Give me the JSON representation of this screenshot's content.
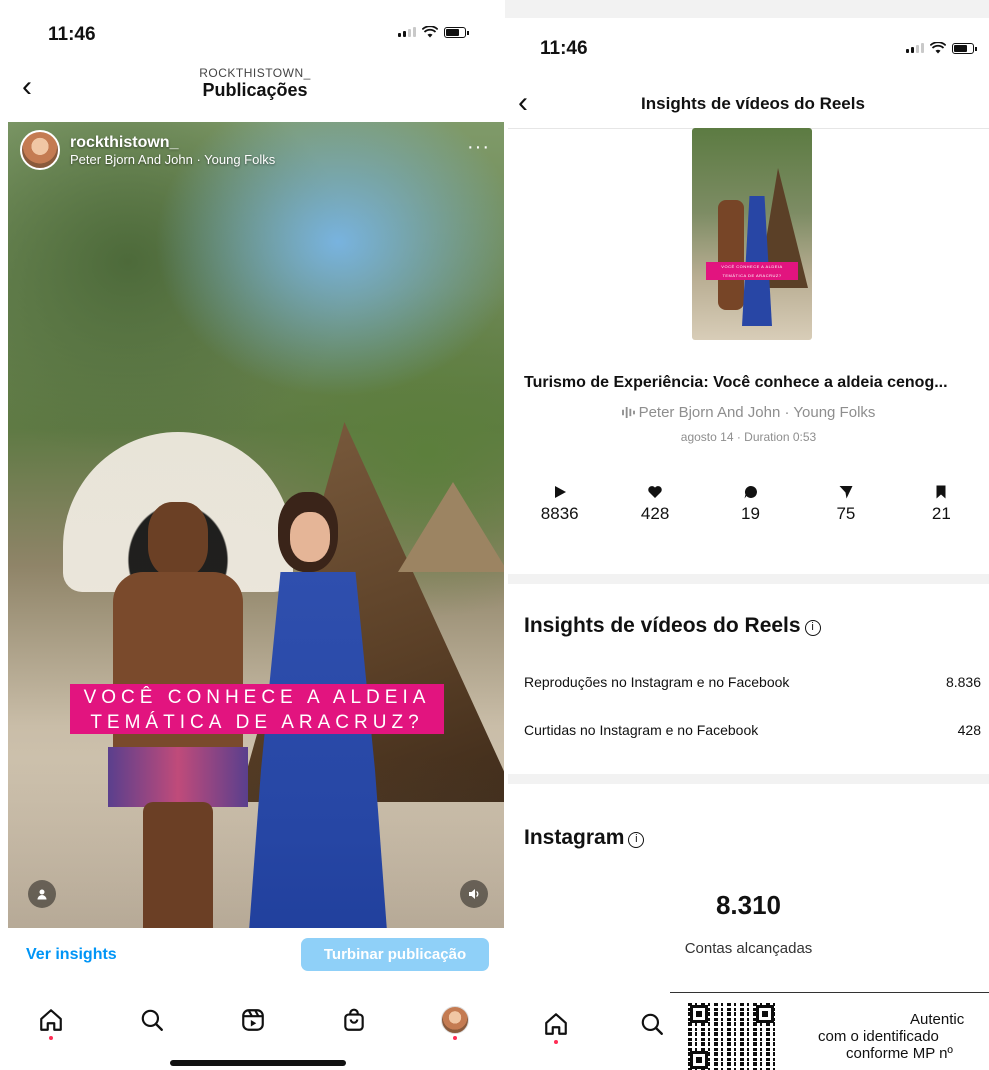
{
  "left": {
    "status_time": "11:46",
    "nav_subtitle": "ROCKTHISTOWN_",
    "nav_title": "Publicações",
    "post": {
      "username": "rockthistown_",
      "music": "Peter Bjorn And John · Young Folks",
      "more": "···",
      "caption_line1": "VOCÊ CONHECE A ALDEIA",
      "caption_line2": "TEMÁTICA DE ARACRUZ?"
    },
    "view_insights": "Ver insights",
    "boost_button": "Turbinar publicação"
  },
  "right": {
    "status_time": "11:46",
    "nav_title": "Insights de vídeos do Reels",
    "reel_title": "Turismo de Experiência: Você conhece a aldeia cenog...",
    "reel_music": "Peter Bjorn And John · Young Folks",
    "reel_date": "agosto 14 · Duration 0:53",
    "stats": [
      {
        "icon": "play-icon",
        "value": "8836"
      },
      {
        "icon": "heart-icon",
        "value": "428"
      },
      {
        "icon": "comment-icon",
        "value": "19"
      },
      {
        "icon": "share-icon",
        "value": "75"
      },
      {
        "icon": "bookmark-icon",
        "value": "21"
      }
    ],
    "section1_title": "Insights de vídeos do Reels",
    "rows": [
      {
        "label": "Reproduções no Instagram e no Facebook",
        "value": "8.836"
      },
      {
        "label": "Curtidas no Instagram e no Facebook",
        "value": "428"
      }
    ],
    "section2_title": "Instagram",
    "accounts_reached": "8.310",
    "accounts_reached_label": "Contas alcançadas"
  },
  "watermark": {
    "line1": "Autentic",
    "line2": "com o identificado",
    "line3": "conforme MP nº"
  },
  "colors": {
    "link_blue": "#0095f6",
    "boost_button": "#8fd0f8",
    "caption_pink": "#e2147f",
    "notification_dot": "#ff2d55"
  }
}
